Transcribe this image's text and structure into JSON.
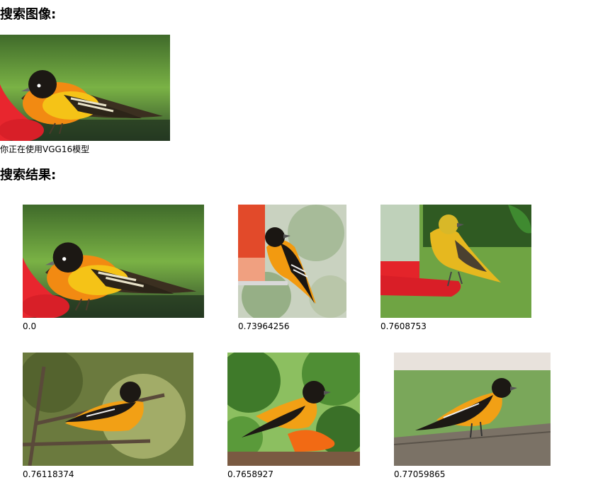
{
  "query": {
    "heading": "搜索图像:",
    "model_note": "你正在使用VGG16模型"
  },
  "results": {
    "heading": "搜索结果:",
    "items": [
      {
        "score": "0.0"
      },
      {
        "score": "0.73964256"
      },
      {
        "score": "0.7608753"
      },
      {
        "score": "0.76118374"
      },
      {
        "score": "0.7658927"
      },
      {
        "score": "0.77059865"
      }
    ]
  }
}
